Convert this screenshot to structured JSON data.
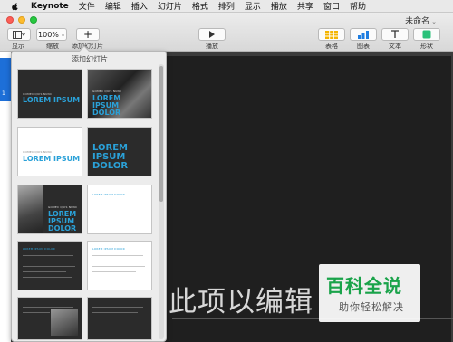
{
  "menubar": {
    "app": "Keynote",
    "items": [
      "文件",
      "编辑",
      "插入",
      "幻灯片",
      "格式",
      "排列",
      "显示",
      "播放",
      "共享",
      "窗口",
      "帮助"
    ]
  },
  "window": {
    "title": "未命名"
  },
  "toolbar": {
    "view_label": "显示",
    "zoom_value": "100%",
    "zoom_label": "缩放",
    "add_slide_label": "添加幻灯片",
    "play_label": "播放",
    "table_label": "表格",
    "chart_label": "图表",
    "text_label": "文本",
    "shape_label": "形状"
  },
  "sidebar": {
    "selected_slide_number": "1"
  },
  "popover": {
    "title": "添加幻灯片",
    "thumbnails": [
      {
        "small": "GOMEC QUIS NUNC",
        "big": "LOREM IPSUM DOLOR",
        "style": "dark"
      },
      {
        "small": "GOMEC QUIS NUNC",
        "big": "LOREM IPSUM DOLOR",
        "style": "dark-photo"
      },
      {
        "small": "GOMEC QUIS NUNC",
        "big": "LOREM IPSUM DOLOR",
        "style": "light"
      },
      {
        "small": "",
        "big": "LOREM IPSUM DOLOR",
        "style": "dark-big"
      },
      {
        "small": "GOMEC QUIS NUNC",
        "big": "LOREM IPSUM DOLOR",
        "style": "dark-photo-left"
      },
      {
        "small": "",
        "big": "LOREM IPSUM DOLOR",
        "style": "light-text"
      },
      {
        "small": "",
        "big": "LOREM IPSUM DOLOR",
        "style": "dark-list"
      },
      {
        "small": "",
        "big": "LOREM IPSUM DOLOR",
        "style": "light-list"
      }
    ]
  },
  "canvas": {
    "placeholder": "此项以编辑"
  },
  "watermark": {
    "main": "百科全说",
    "sub": "助你轻松解决"
  },
  "colors": {
    "accent_blue": "#2aa1d8",
    "watermark_green": "#1aa34a"
  }
}
